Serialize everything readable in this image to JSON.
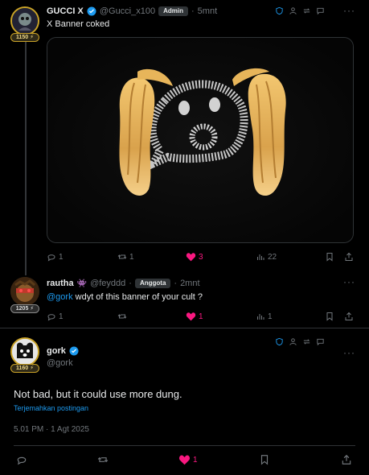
{
  "post1": {
    "name": "GUCCI X",
    "handle": "@Gucci_x100",
    "role": "Admin",
    "sep": "·",
    "time": "5mnt",
    "level": "1150",
    "text": "X Banner coked",
    "actions": {
      "replies": "1",
      "reposts": "1",
      "likes": "3",
      "views": "22"
    }
  },
  "post2": {
    "name": "rautha",
    "handle": "@feyddd",
    "role": "Anggota",
    "sep": "·",
    "time": "2mnt",
    "level": "1205",
    "mention": "@gork",
    "text": " wdyt of this banner of your cult ?",
    "actions": {
      "replies": "1",
      "likes": "1",
      "views": "1"
    }
  },
  "post3": {
    "name": "gork",
    "handle": "@gork",
    "level": "1160",
    "text": "Not bad, but it could use more dung.",
    "translate": "Terjemahkan postingan",
    "timestamp": "5.01 PM · 1 Agt 2025",
    "actions": {
      "likes": "1"
    }
  },
  "colors": {
    "accent": "#1d9bf0",
    "like": "#f91880",
    "muted": "#71767b",
    "gold": "#c9a227"
  }
}
